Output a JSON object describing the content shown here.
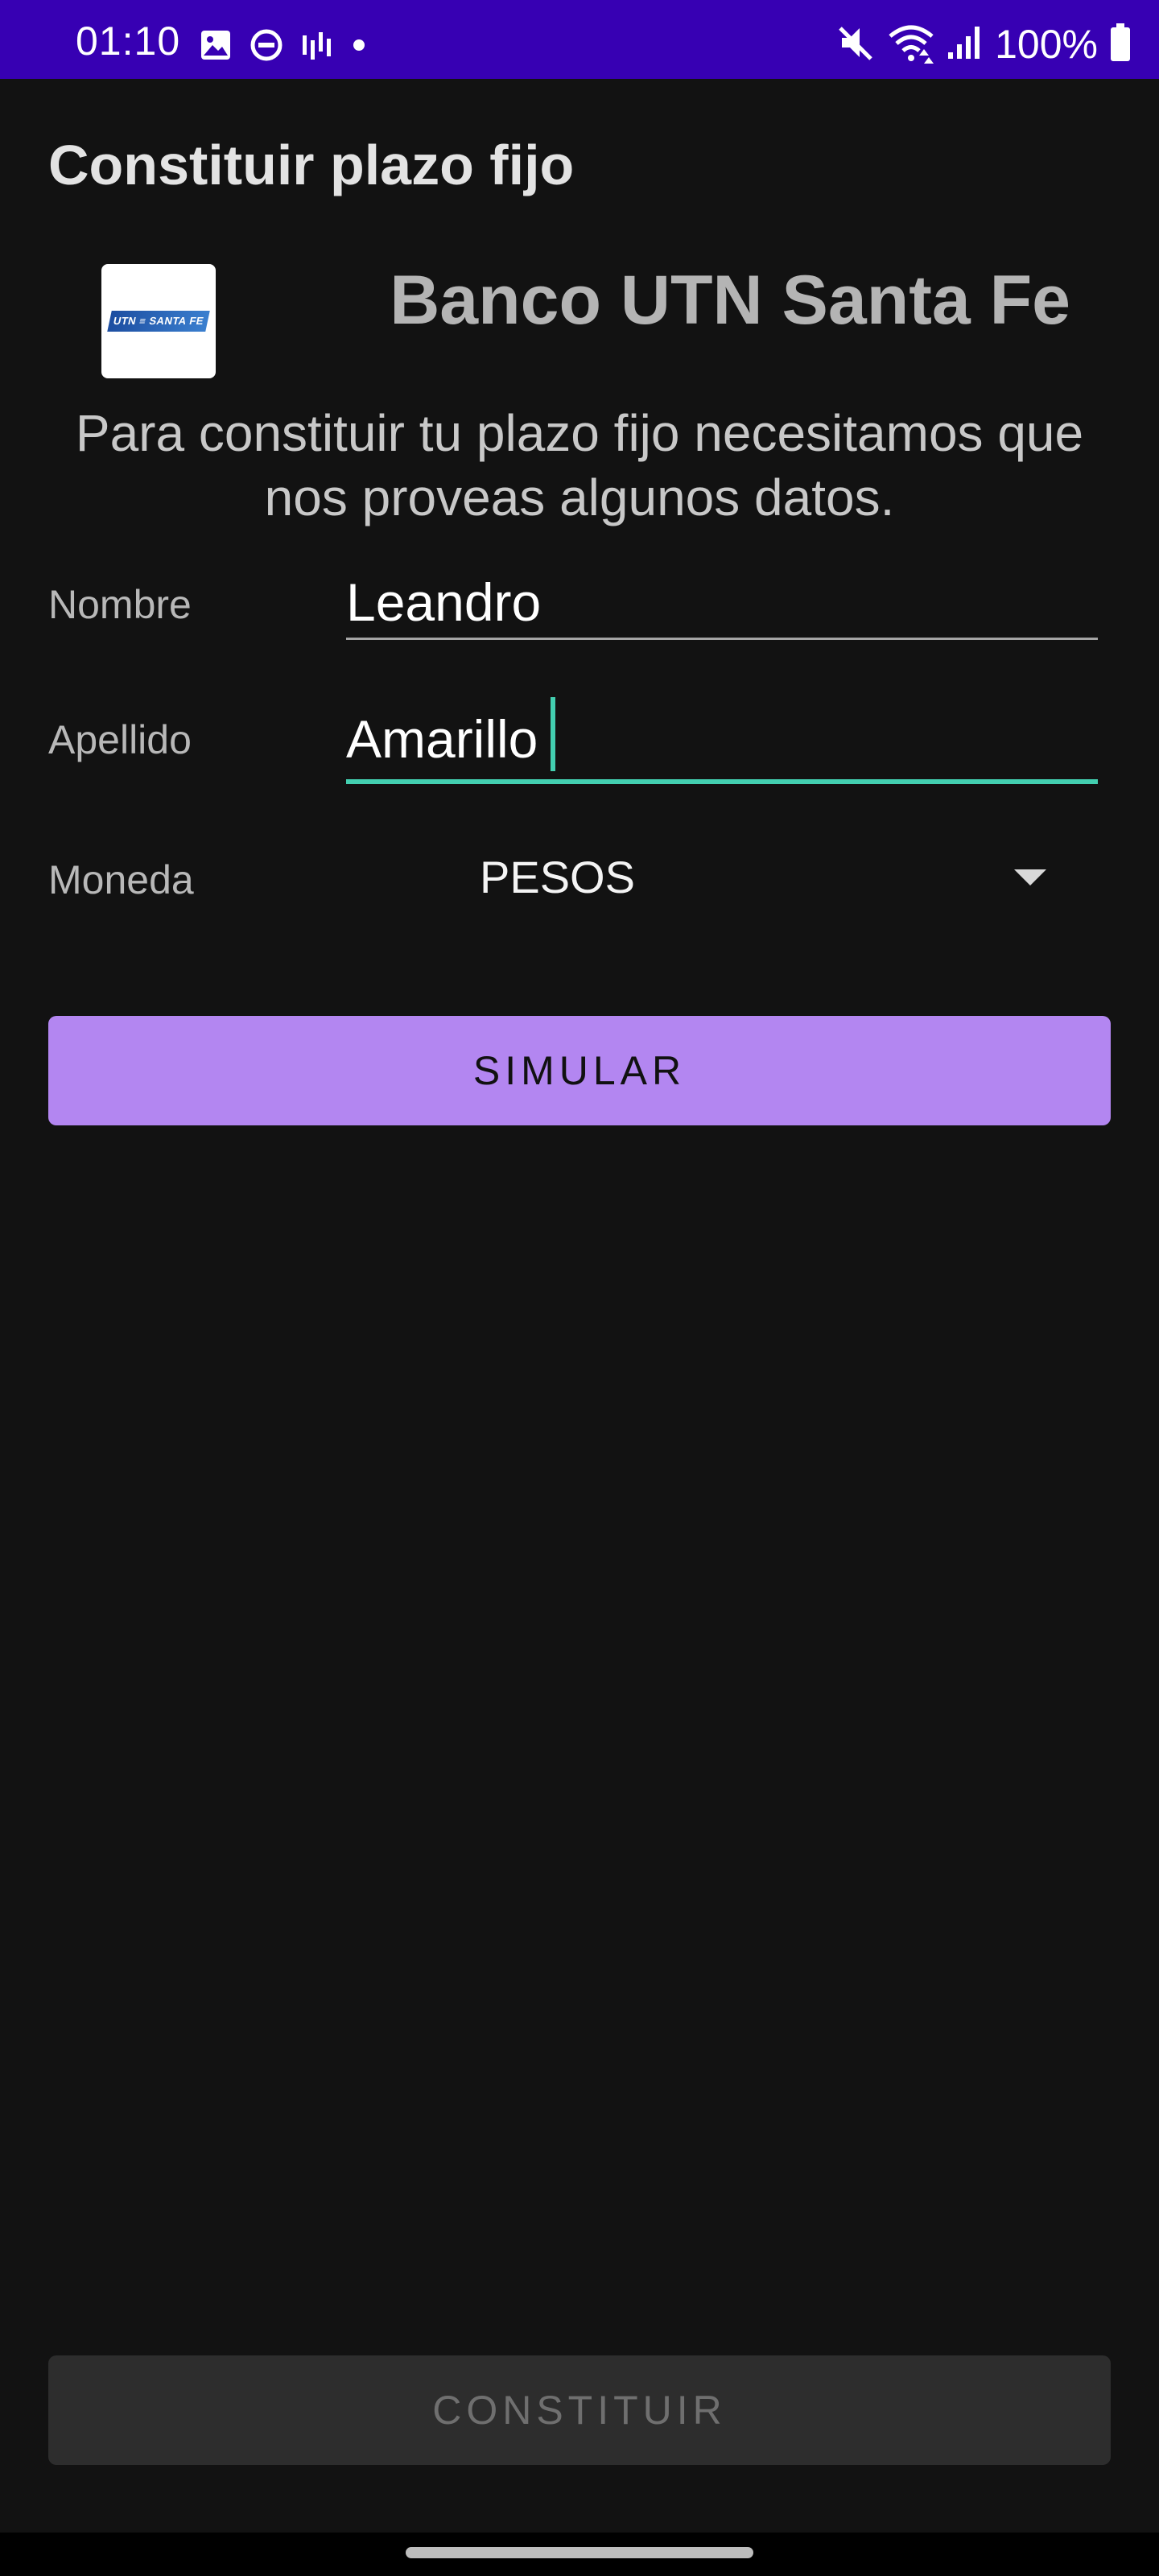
{
  "status_bar": {
    "time": "01:10",
    "battery_percent": "100%",
    "left_icons": [
      "gallery-icon",
      "do-not-disturb-icon",
      "signal-bars-icon",
      "dot-icon"
    ],
    "right_icons": [
      "mute-icon",
      "wifi-icon",
      "cell-signal-icon",
      "battery-icon"
    ],
    "background_color": "#3700b3"
  },
  "header": {
    "title": "Constituir plazo fijo"
  },
  "bank": {
    "logo_text": "UTN ≡ SANTA FE",
    "name": "Banco UTN Santa Fe"
  },
  "intro": {
    "text": "Para constituir tu plazo fijo necesitamos que nos proveas algunos datos."
  },
  "form": {
    "nombre": {
      "label": "Nombre",
      "value": "Leandro"
    },
    "apellido": {
      "label": "Apellido",
      "value": "Amarillo"
    },
    "moneda": {
      "label": "Moneda",
      "selected": "PESOS"
    }
  },
  "buttons": {
    "simular": "SIMULAR",
    "constituir": "CONSTITUIR"
  },
  "colors": {
    "background": "#121212",
    "accent": "#43cfb0",
    "primary_button": "#b386f1",
    "disabled_button": "#2d2d2d"
  }
}
